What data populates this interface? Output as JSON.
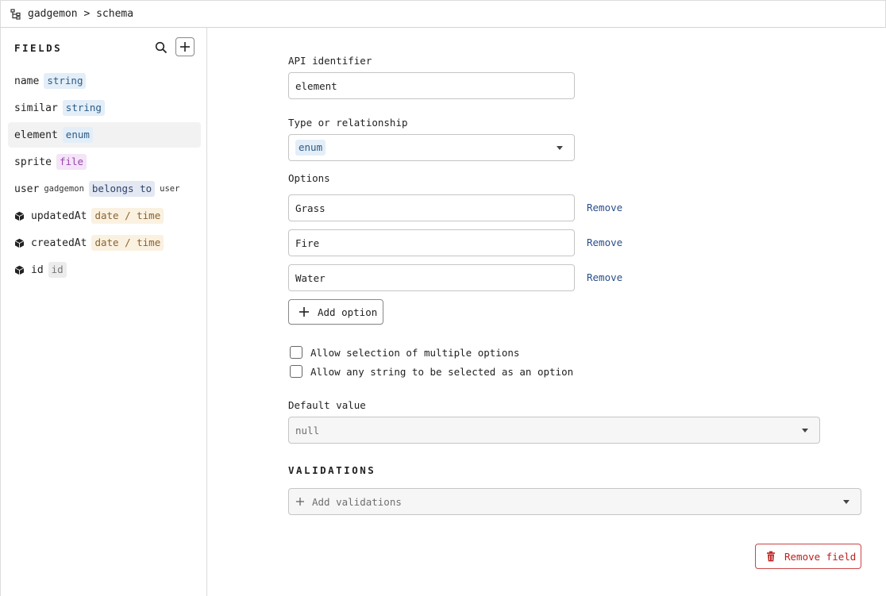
{
  "breadcrumb": {
    "text": "gadgemon > schema"
  },
  "sidebar": {
    "title": "FIELDS",
    "fields": [
      {
        "name": "name",
        "type": "string"
      },
      {
        "name": "similar",
        "type": "string"
      },
      {
        "name": "element",
        "type": "enum"
      },
      {
        "name": "sprite",
        "type": "file"
      },
      {
        "name": "user",
        "target_model": "gadgemon",
        "type": "belongs to",
        "related": "user"
      },
      {
        "name": "updatedAt",
        "type": "date / time"
      },
      {
        "name": "createdAt",
        "type": "date / time"
      },
      {
        "name": "id",
        "type": "id"
      }
    ]
  },
  "form": {
    "api_identifier": {
      "label": "API identifier",
      "value": "element"
    },
    "type": {
      "label": "Type or relationship",
      "value": "enum"
    },
    "options": {
      "label": "Options",
      "items": [
        "Grass",
        "Fire",
        "Water"
      ],
      "remove_label": "Remove",
      "add_label": "Add option"
    },
    "checkboxes": {
      "multiple": "Allow selection of multiple options",
      "any_string": "Allow any string to be selected as an option"
    },
    "default_value": {
      "label": "Default value",
      "value": "null"
    },
    "validations": {
      "title": "VALIDATIONS",
      "placeholder": "Add validations"
    },
    "remove_field": "Remove field"
  }
}
